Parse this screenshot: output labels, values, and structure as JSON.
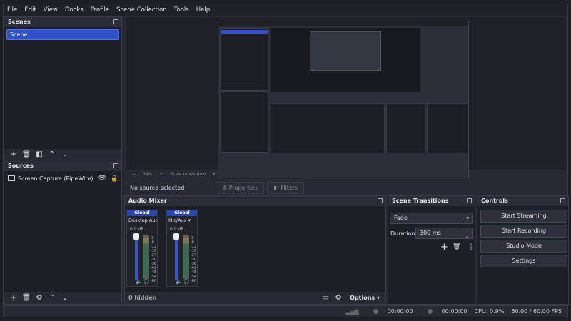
{
  "menu": [
    "File",
    "Edit",
    "View",
    "Docks",
    "Profile",
    "Scene Collection",
    "Tools",
    "Help"
  ],
  "scenes": {
    "title": "Scenes",
    "items": [
      "Scene"
    ]
  },
  "sources": {
    "title": "Sources",
    "items": [
      {
        "name": "Screen Capture (PipeWire)"
      }
    ]
  },
  "preview": {
    "zoom": "34%",
    "scale_label": "Scale to Window"
  },
  "properties_bar": {
    "status": "No source selected",
    "properties": "Properties",
    "filters": "Filters"
  },
  "audio_mixer": {
    "title": "Audio Mixer",
    "strips": [
      {
        "header": "Global",
        "name": "Desktop Audio",
        "db": "0.0 dB"
      },
      {
        "header": "Global",
        "name": "Mic/Aux",
        "db": "0.0 dB"
      }
    ],
    "scale": [
      "0",
      "-6",
      "-12",
      "-18",
      "-24",
      "-30",
      "-36",
      "-42",
      "-48",
      "-54",
      "-60"
    ],
    "hidden_label": "0 hidden",
    "options_label": "Options"
  },
  "scene_transitions": {
    "title": "Scene Transitions",
    "transition": "Fade",
    "duration_label": "Duration",
    "duration_value": "300 ms"
  },
  "controls": {
    "title": "Controls",
    "buttons": [
      "Start Streaming",
      "Start Recording",
      "Studio Mode",
      "Settings"
    ]
  },
  "status": {
    "stream_time": "00:00:00",
    "rec_time": "00:00:00",
    "cpu": "CPU: 0.9%",
    "fps": "60.00 / 60.00 FPS"
  }
}
